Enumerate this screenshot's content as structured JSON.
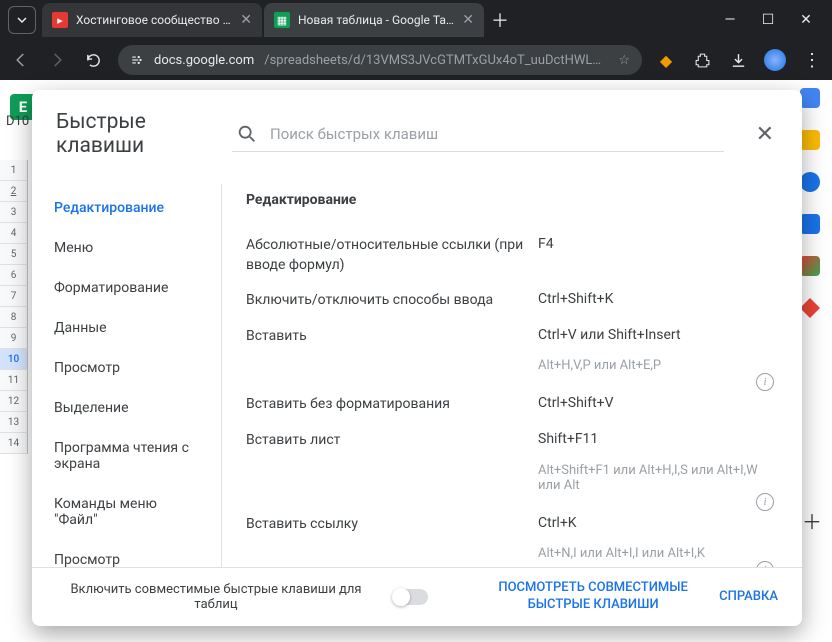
{
  "browser": {
    "tabs": [
      {
        "title": "Хостинговое сообщество «Tim"
      },
      {
        "title": "Новая таблица - Google Табли"
      }
    ],
    "url_domain": "docs.google.com",
    "url_path": "/spreadsheets/d/13VMS3JVcGTMTxGUx4oT_uuDctHWL…"
  },
  "sheet": {
    "cell_ref": "D10",
    "rows": [
      "1",
      "2",
      "3",
      "4",
      "5",
      "6",
      "7",
      "8",
      "9",
      "10",
      "11",
      "12",
      "13",
      "14"
    ],
    "selected_row": "10",
    "underlined_row": "2",
    "logo_letter": "E"
  },
  "modal": {
    "title": "Быстрые клавиши",
    "search_placeholder": "Поиск быстрых клавиш",
    "sidebar": [
      "Редактирование",
      "Меню",
      "Форматирование",
      "Данные",
      "Просмотр",
      "Выделение",
      "Программа чтения с экрана",
      "Команды меню \"Файл\"",
      "Просмотр"
    ],
    "section_title": "Редактирование",
    "shortcuts": [
      {
        "label": "Абсолютные/относительные ссылки (при вводе формул)",
        "keys": "F4",
        "alt": null
      },
      {
        "label": "Включить/отключить способы ввода",
        "keys": "Ctrl+Shift+K",
        "alt": null
      },
      {
        "label": "Вставить",
        "keys": "Ctrl+V или Shift+Insert",
        "alt": "Alt+H,V,P или Alt+E,P"
      },
      {
        "label": "Вставить без форматирования",
        "keys": "Ctrl+Shift+V",
        "alt": null
      },
      {
        "label": "Вставить лист",
        "keys": "Shift+F11",
        "alt": "Alt+Shift+F1 или Alt+H,I,S или Alt+I,W или Alt"
      },
      {
        "label": "Вставить ссылку",
        "keys": "Ctrl+K",
        "alt": "Alt+N,I или Alt+I,I или Alt+I,K"
      }
    ],
    "footer": {
      "compat": "Включить совместимые быстрые клавиши для таблиц",
      "view_compat": "ПОСМОТРЕТЬ СОВМЕСТИМЫЕ БЫСТРЫЕ КЛАВИШИ",
      "help": "СПРАВКА"
    }
  }
}
